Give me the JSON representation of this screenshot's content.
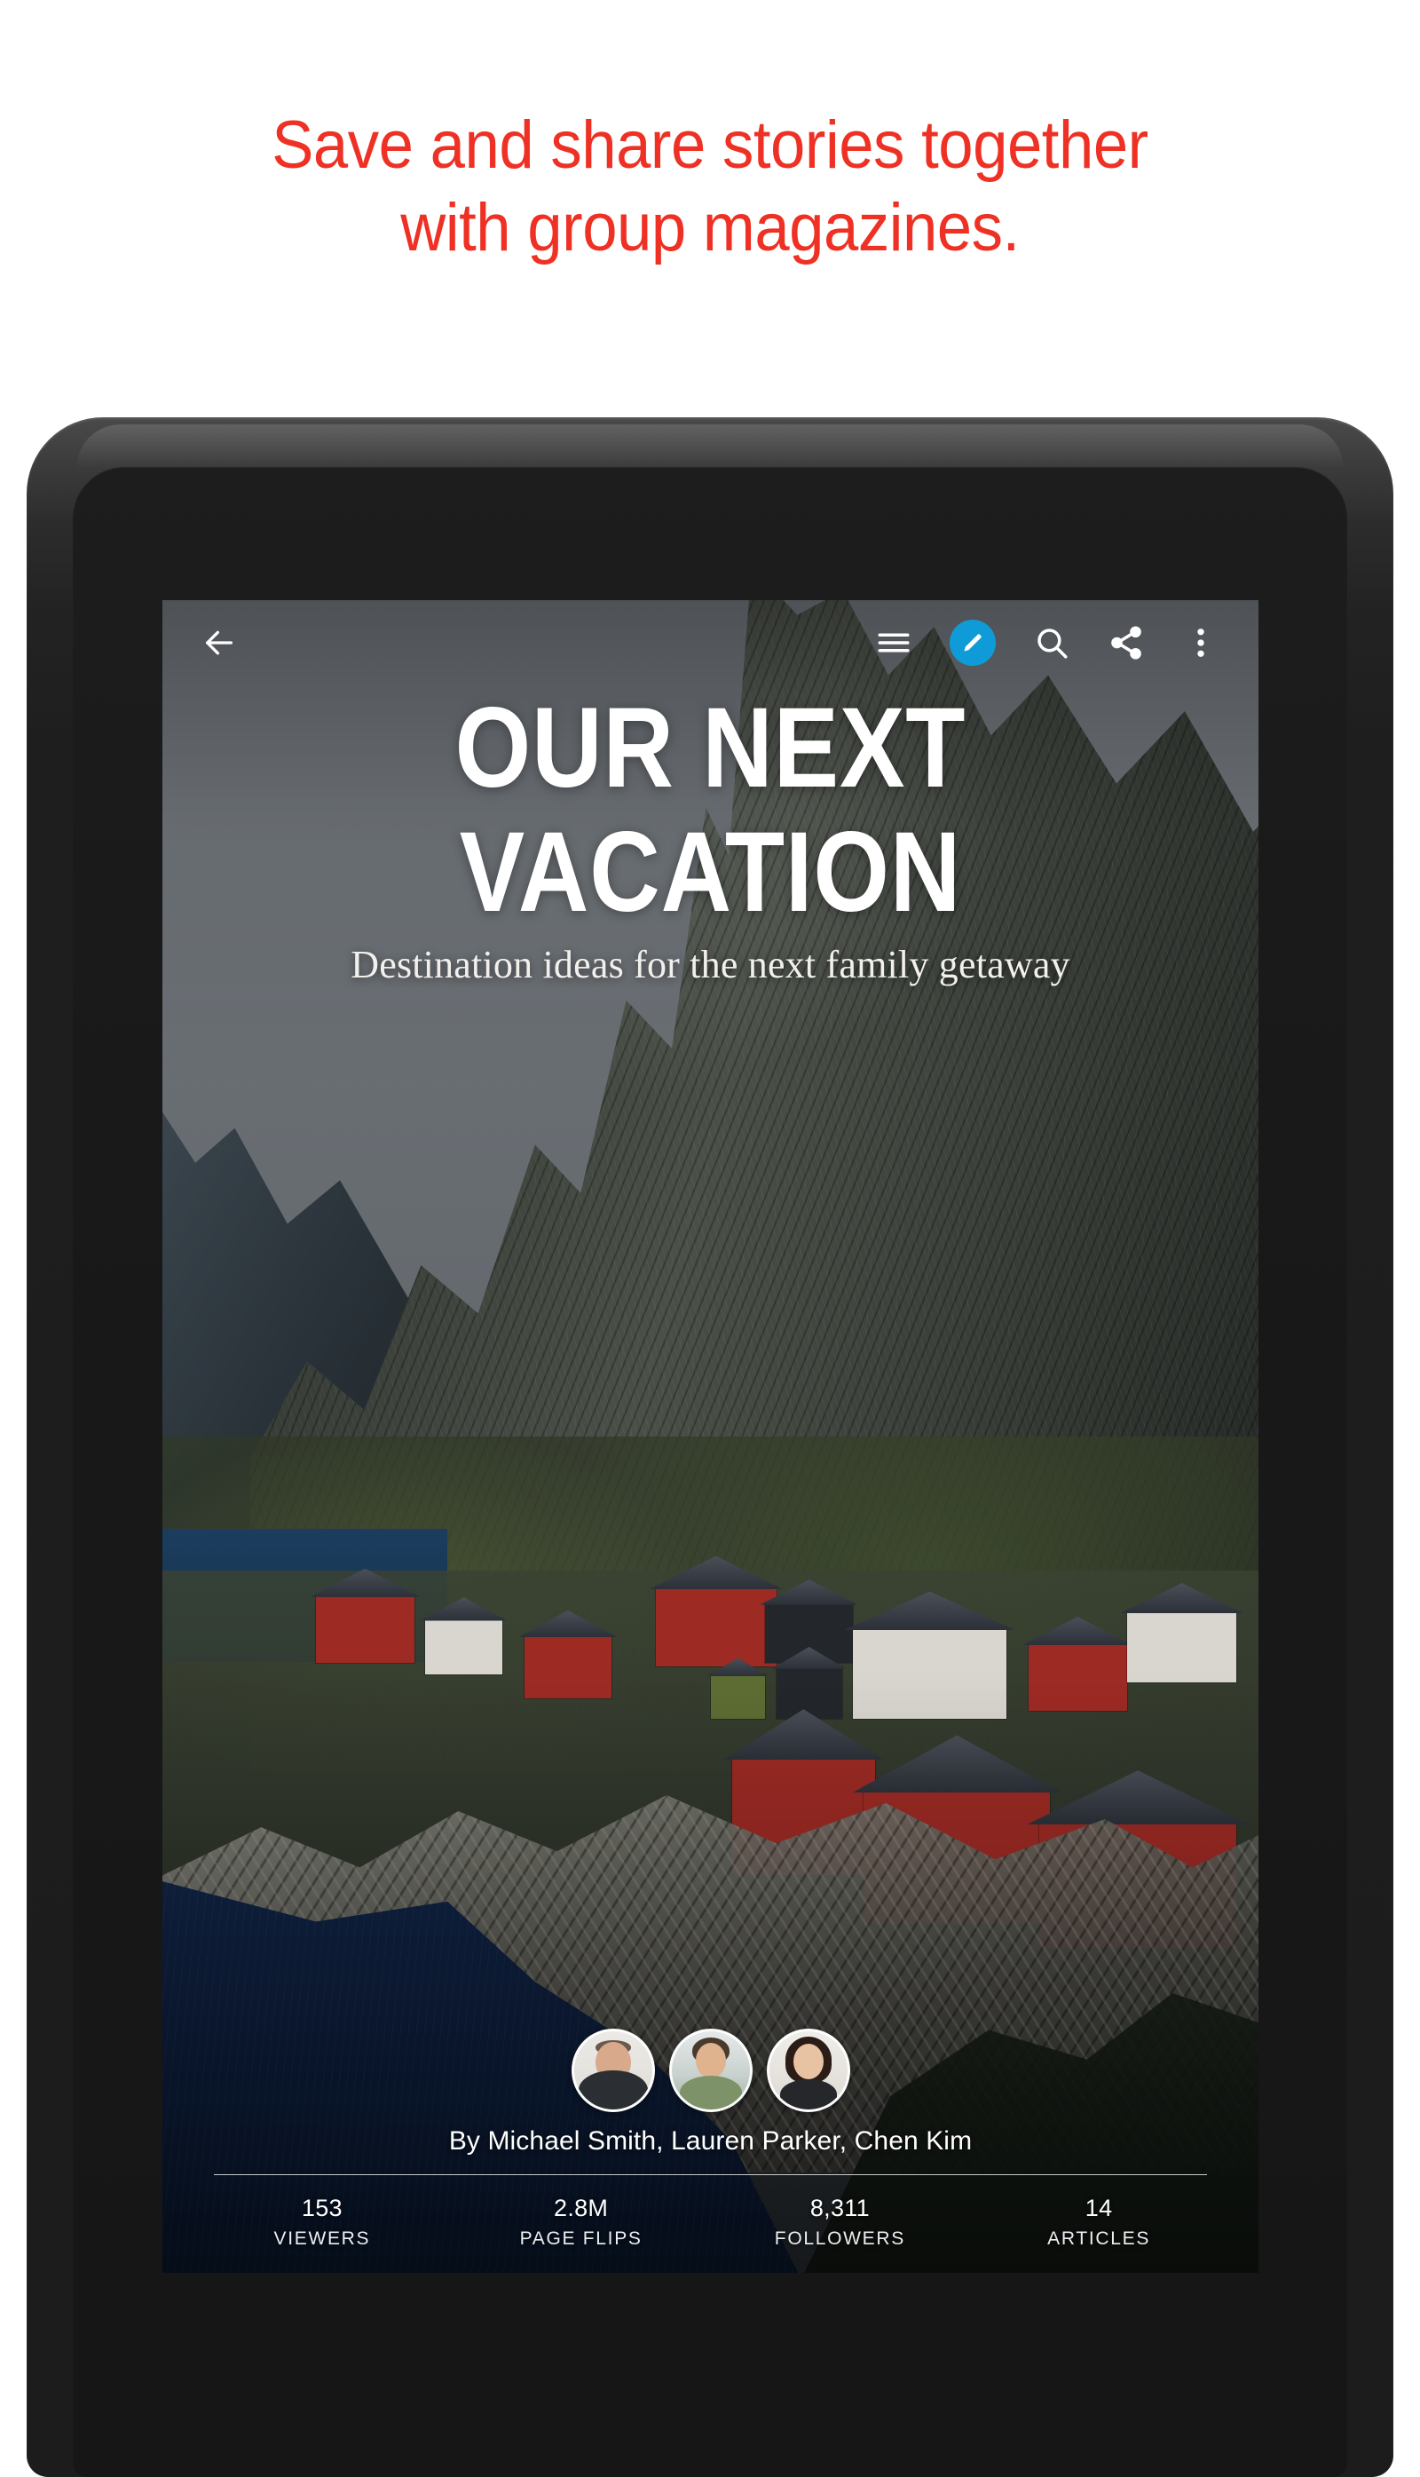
{
  "promo": {
    "line1": "Save and share stories together",
    "line2": "with group magazines.",
    "color": "#ee3124"
  },
  "toolbar": {
    "back_label": "Back",
    "toc_label": "Table of contents",
    "edit_label": "Edit magazine",
    "search_label": "Search",
    "share_label": "Share",
    "more_label": "More options",
    "accent_color": "#0f9bd7"
  },
  "cover": {
    "title_line1": "OUR NEXT",
    "title_line2": "VACATION",
    "subtitle": "Destination ideas for the next family getaway",
    "byline": "By Michael Smith, Lauren Parker, Chen Kim",
    "contributors": [
      {
        "name": "Michael Smith"
      },
      {
        "name": "Lauren Parker"
      },
      {
        "name": "Chen Kim"
      }
    ],
    "stats": [
      {
        "value": "153",
        "label": "VIEWERS"
      },
      {
        "value": "2.8M",
        "label": "PAGE FLIPS"
      },
      {
        "value": "8,311",
        "label": "FOLLOWERS"
      },
      {
        "value": "14",
        "label": "ARTICLES"
      }
    ]
  }
}
